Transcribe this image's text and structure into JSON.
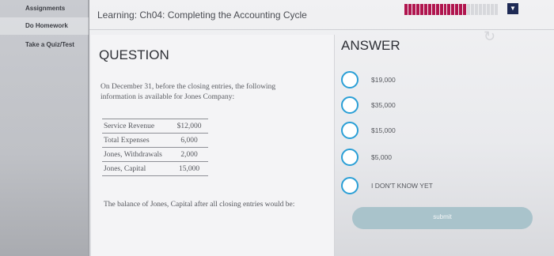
{
  "sidebar": {
    "items": [
      {
        "label": "Assignments"
      },
      {
        "label": "Do Homework"
      },
      {
        "label": "Take a Quiz/Test"
      }
    ]
  },
  "header": {
    "title": "Learning: Ch04: Completing the Accounting Cycle"
  },
  "question": {
    "heading": "QUESTION",
    "text": "On December 31, before the closing entries, the following information is available for Jones Company:",
    "table": [
      {
        "account": "Service Revenue",
        "amount": "$12,000"
      },
      {
        "account": "Total Expenses",
        "amount": "6,000"
      },
      {
        "account": "Jones, Withdrawals",
        "amount": "2,000"
      },
      {
        "account": "Jones, Capital",
        "amount": "15,000"
      }
    ],
    "prompt": "The balance of Jones, Capital after all closing entries would be:"
  },
  "answer": {
    "heading": "ANSWER",
    "options": [
      {
        "label": "$19,000"
      },
      {
        "label": "$35,000"
      },
      {
        "label": "$15,000"
      },
      {
        "label": "$5,000"
      },
      {
        "label": "I DON'T KNOW YET"
      }
    ],
    "submit_label": "submit"
  },
  "colors": {
    "accent": "#2a9fd6",
    "progress": "#b0144e",
    "submit": "#a9c3cb"
  }
}
